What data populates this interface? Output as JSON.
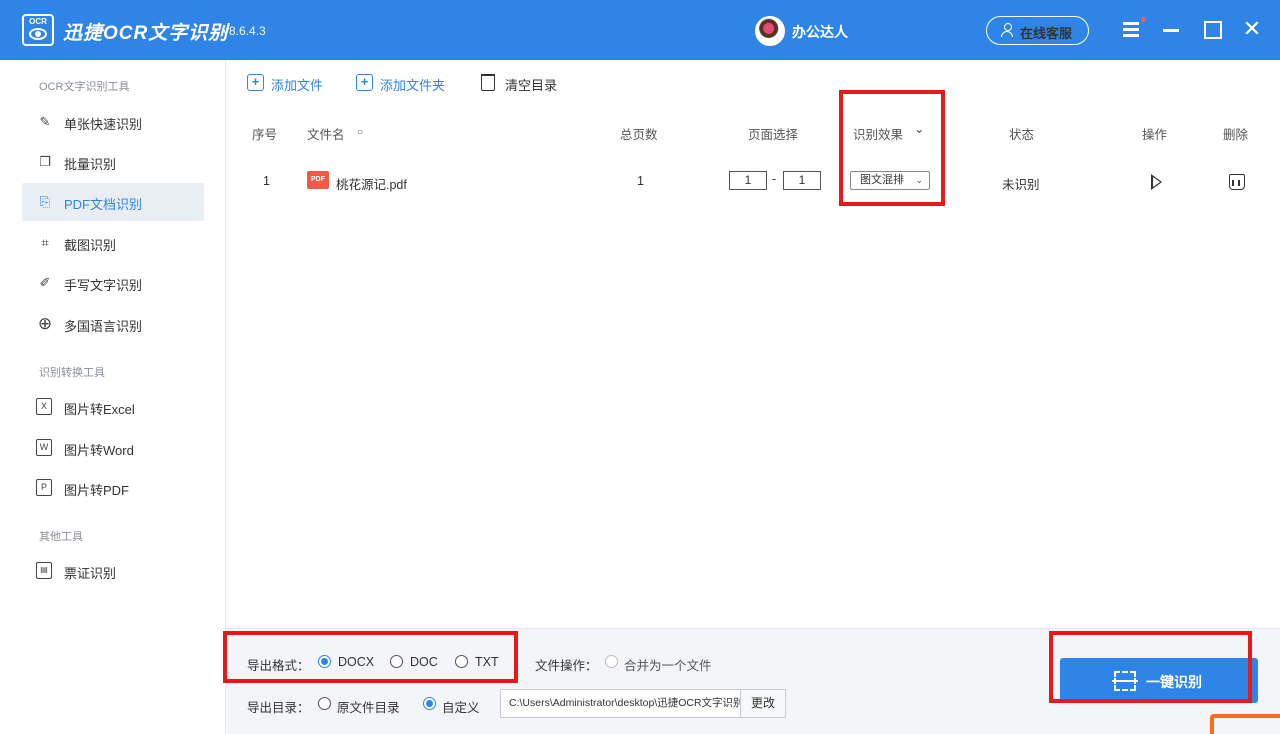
{
  "app": {
    "title": "迅捷OCR文字识别",
    "version": "v8.6.4.3",
    "logo_text": "OCR",
    "user_name": "办公达人",
    "service_label": "在线客服",
    "close_glyph": "✕"
  },
  "sidebar": {
    "section_ocr": "OCR文字识别工具",
    "section_convert": "识别转换工具",
    "section_other": "其他工具",
    "ocr_items": [
      {
        "label": "单张快速识别",
        "icon": "edit-icon"
      },
      {
        "label": "批量识别",
        "icon": "copy-icon"
      },
      {
        "label": "PDF文档识别",
        "icon": "pdf-doc-icon",
        "active": true
      },
      {
        "label": "截图识别",
        "icon": "crop-icon"
      },
      {
        "label": "手写文字识别",
        "icon": "pen-icon"
      },
      {
        "label": "多国语言识别",
        "icon": "globe-icon"
      }
    ],
    "convert_items": [
      {
        "label": "图片转Excel",
        "glyph": "X"
      },
      {
        "label": "图片转Word",
        "glyph": "W"
      },
      {
        "label": "图片转PDF",
        "glyph": "P"
      }
    ],
    "other_items": [
      {
        "label": "票证识别",
        "icon": "ticket-icon"
      }
    ]
  },
  "toolbar": {
    "add_file": "添加文件",
    "add_folder": "添加文件夹",
    "clear_list": "清空目录"
  },
  "table": {
    "headers": {
      "index": "序号",
      "filename": "文件名",
      "filename_sort": "○",
      "pages": "总页数",
      "page_select": "页面选择",
      "effect": "识别效果",
      "effect_chevron": "⌄",
      "status": "状态",
      "action": "操作",
      "delete": "删除"
    },
    "rows": [
      {
        "index": "1",
        "file_icon": "PDF",
        "filename": "桃花源记.pdf",
        "pages": "1",
        "page_from": "1",
        "page_sep": "-",
        "page_to": "1",
        "effect": "图文混排",
        "status": "未识别"
      }
    ]
  },
  "bottom": {
    "export_format_label": "导出格式：",
    "formats": [
      {
        "label": "DOCX",
        "selected": true
      },
      {
        "label": "DOC",
        "selected": false
      },
      {
        "label": "TXT",
        "selected": false
      }
    ],
    "file_op_label": "文件操作：",
    "merge_label": "合并为一个文件",
    "export_dir_label": "导出目录：",
    "dir_options": [
      {
        "label": "原文件目录",
        "selected": false
      },
      {
        "label": "自定义",
        "selected": true
      }
    ],
    "dir_path": "C:\\Users\\Administrator\\desktop\\迅捷OCR文字识别",
    "change_label": "更改",
    "start_label": "一键识别"
  },
  "colors": {
    "brand": "#2f84e8",
    "highlight": "#e8191b",
    "pdf_icon": "#f15a45"
  }
}
